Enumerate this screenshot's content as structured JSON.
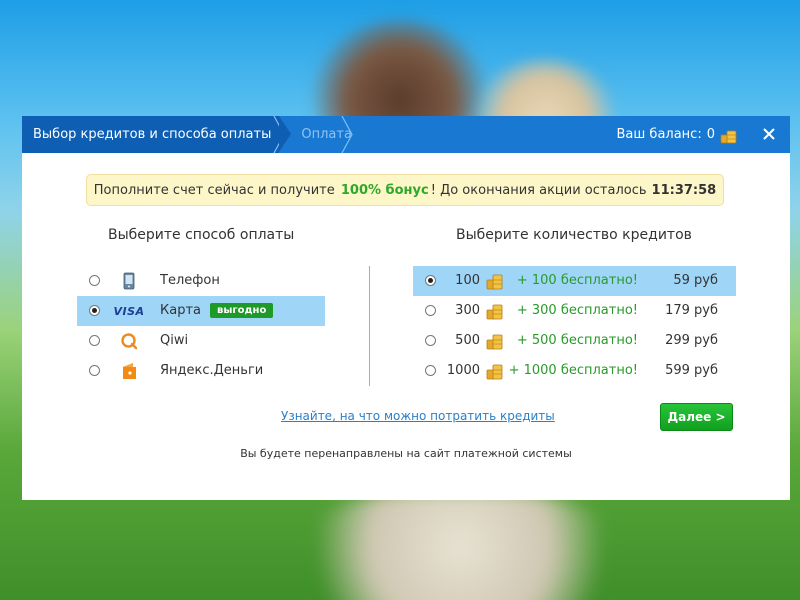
{
  "header": {
    "step_active": "Выбор кредитов и способа оплаты",
    "step_next": "Оплата",
    "balance_label": "Ваш баланс:",
    "balance_value": "0",
    "close_icon": "close-icon"
  },
  "promo": {
    "text_before": "Пополните счет сейчас и получите",
    "bonus": "100% бонус",
    "text_after": "! До окончания акции осталось",
    "timer": "11:37:58"
  },
  "payment": {
    "title": "Выберите способ оплаты",
    "selected_index": 1,
    "methods": [
      {
        "label": "Телефон",
        "icon": "phone-icon"
      },
      {
        "label": "Карта",
        "icon": "visa-icon",
        "brand": "VISA",
        "badge": "выгодно"
      },
      {
        "label": "Qiwi",
        "icon": "qiwi-icon"
      },
      {
        "label": "Яндекс.Деньги",
        "icon": "yandex-money-icon"
      }
    ]
  },
  "credits": {
    "title": "Выберите количество кредитов",
    "selected_index": 0,
    "options": [
      {
        "amount": "100",
        "bonus": "+ 100 бесплатно!",
        "price": "59 руб"
      },
      {
        "amount": "300",
        "bonus": "+ 300 бесплатно!",
        "price": "179 руб"
      },
      {
        "amount": "500",
        "bonus": "+ 500 бесплатно!",
        "price": "299 руб"
      },
      {
        "amount": "1000",
        "bonus": "+ 1000 бесплатно!",
        "price": "599 руб"
      }
    ]
  },
  "footer": {
    "learn_link": "Узнайте, на что можно потратить кредиты",
    "next_button": "Далее >",
    "redirect_note": "Вы будете перенаправлены на сайт платежной системы"
  },
  "colors": {
    "header_bg": "#1978d2",
    "header_active_bg": "#0e5fb3",
    "selected_row": "#9fd5f7",
    "bonus_green": "#2ea82a",
    "button_green": "#12a01e",
    "link_blue": "#2a7fc8"
  }
}
